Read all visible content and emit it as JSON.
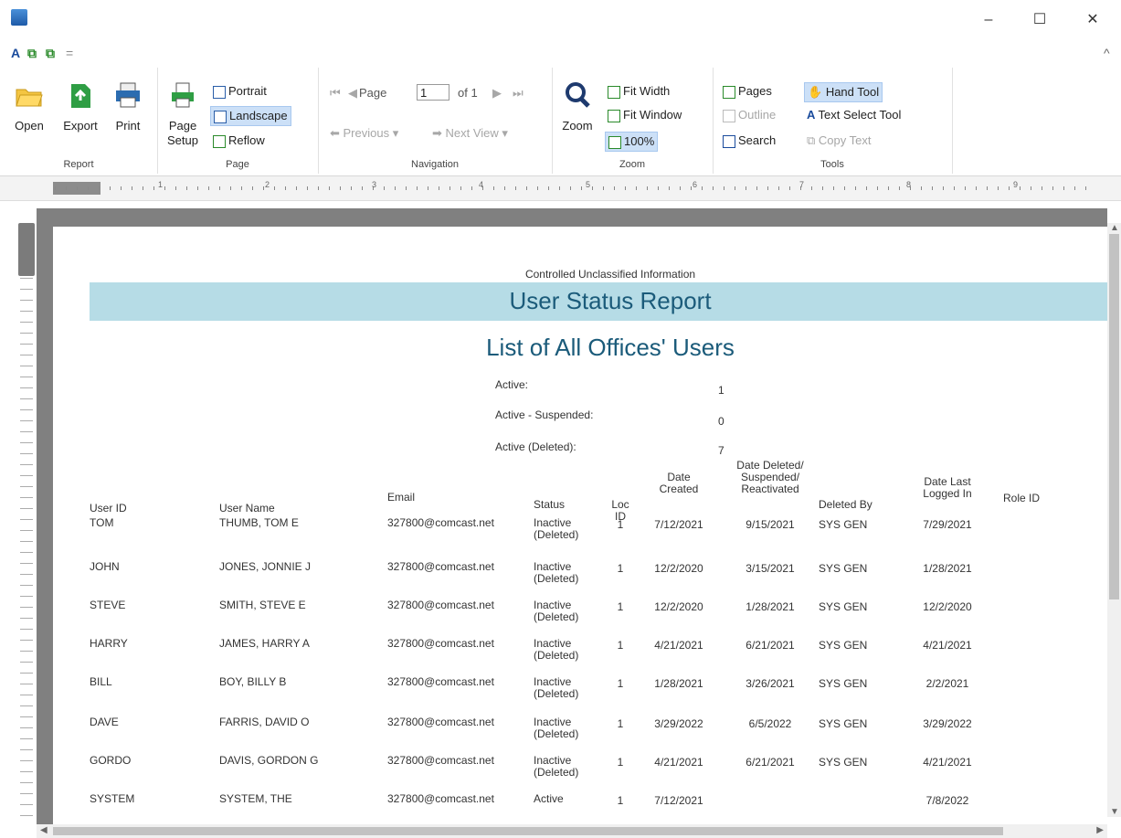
{
  "window": {
    "minimize": "–",
    "maximize": "☐",
    "close": "✕"
  },
  "qat": {
    "items": [
      "A",
      "⧉",
      "⧉",
      "="
    ],
    "collapse": "^"
  },
  "ribbon": {
    "report": {
      "label": "Report",
      "open": "Open",
      "export": "Export",
      "print": "Print"
    },
    "page": {
      "label": "Page",
      "page_setup": "Page Setup",
      "portrait": "Portrait",
      "landscape": "Landscape",
      "reflow": "Reflow"
    },
    "navigation": {
      "label": "Navigation",
      "page_word": "Page",
      "page_value": "1",
      "of_text": "of 1",
      "previous": "Previous",
      "next_view": "Next View"
    },
    "zoom": {
      "label": "Zoom",
      "zoom": "Zoom",
      "fit_width": "Fit Width",
      "fit_window": "Fit Window",
      "zoom_100": "100%"
    },
    "tools": {
      "label": "Tools",
      "pages": "Pages",
      "outline": "Outline",
      "search": "Search",
      "hand_tool": "Hand Tool",
      "text_select_tool": "Text Select Tool",
      "copy_text": "Copy Text"
    }
  },
  "report": {
    "classification": "Controlled Unclassified Information",
    "title": "User Status Report",
    "subtitle": "List of All Offices' Users",
    "summary": [
      {
        "label": "Active:",
        "value": "1"
      },
      {
        "label": "Active - Suspended:",
        "value": "0"
      },
      {
        "label": "Active (Deleted):",
        "value": "7"
      }
    ],
    "columns": [
      "User ID",
      "User Name",
      "Email",
      "Status",
      "Loc ID",
      "Date Created",
      "Date Deleted/ Suspended/ Reactivated",
      "Deleted By",
      "Date Last Logged In",
      "Role ID"
    ],
    "rows": [
      [
        "TOM",
        "THUMB, TOM E",
        "327800@comcast.net",
        "Inactive (Deleted)",
        "1",
        "7/12/2021",
        "9/15/2021",
        "SYS GEN",
        "7/29/2021",
        ""
      ],
      [
        "JOHN",
        "JONES, JONNIE J",
        "327800@comcast.net",
        "Inactive (Deleted)",
        "1",
        "12/2/2020",
        "3/15/2021",
        "SYS GEN",
        "1/28/2021",
        ""
      ],
      [
        "STEVE",
        "SMITH, STEVE E",
        "327800@comcast.net",
        "Inactive (Deleted)",
        "1",
        "12/2/2020",
        "1/28/2021",
        "SYS GEN",
        "12/2/2020",
        ""
      ],
      [
        "HARRY",
        "JAMES, HARRY A",
        "327800@comcast.net",
        "Inactive (Deleted)",
        "1",
        "4/21/2021",
        "6/21/2021",
        "SYS GEN",
        "4/21/2021",
        ""
      ],
      [
        "BILL",
        "BOY, BILLY B",
        "327800@comcast.net",
        "Inactive (Deleted)",
        "1",
        "1/28/2021",
        "3/26/2021",
        "SYS GEN",
        "2/2/2021",
        ""
      ],
      [
        "DAVE",
        "FARRIS, DAVID O",
        "327800@comcast.net",
        "Inactive (Deleted)",
        "1",
        "3/29/2022",
        "6/5/2022",
        "SYS GEN",
        "3/29/2022",
        ""
      ],
      [
        "GORDO",
        "DAVIS, GORDON G",
        "327800@comcast.net",
        "Inactive (Deleted)",
        "1",
        "4/21/2021",
        "6/21/2021",
        "SYS GEN",
        "4/21/2021",
        ""
      ],
      [
        "SYSTEM",
        "SYSTEM, THE",
        "327800@comcast.net",
        "Active",
        "1",
        "7/12/2021",
        "",
        "",
        "7/8/2022",
        ""
      ]
    ]
  },
  "ruler": {
    "numbers": [
      "1",
      "2",
      "3",
      "4",
      "5",
      "6",
      "7",
      "8",
      "9"
    ]
  }
}
